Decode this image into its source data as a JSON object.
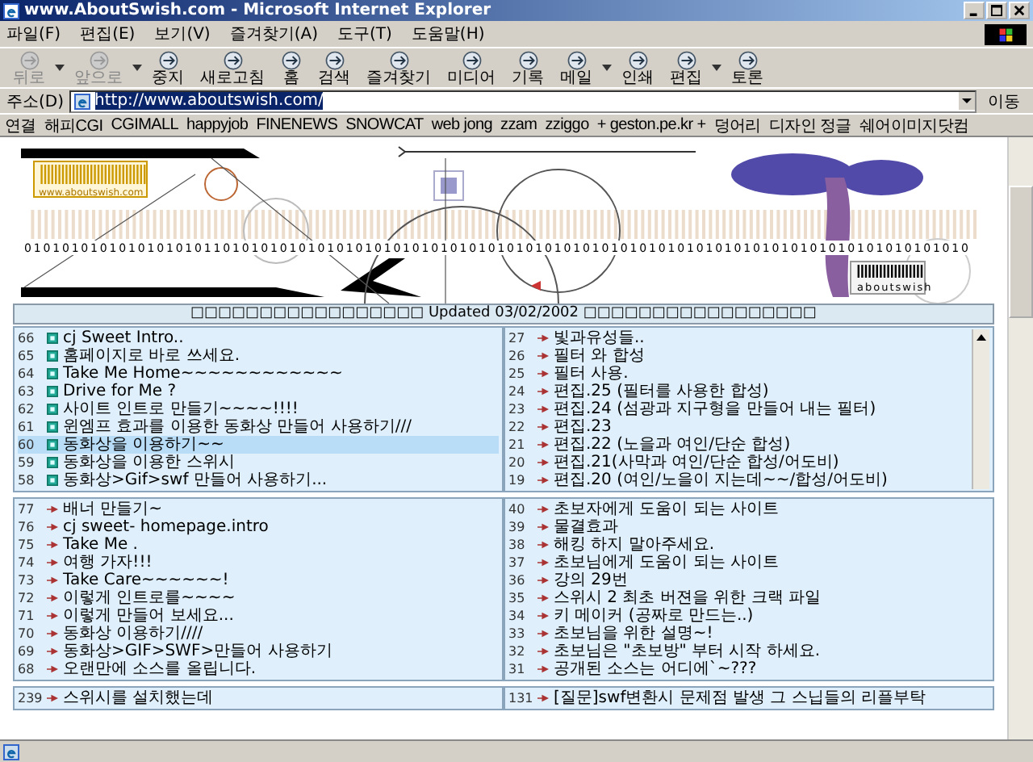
{
  "window": {
    "title": "www.AboutSwish.com - Microsoft Internet Explorer"
  },
  "menu": [
    "파일(F)",
    "편집(E)",
    "보기(V)",
    "즐겨찾기(A)",
    "도구(T)",
    "도움말(H)"
  ],
  "toolbar": [
    {
      "label": "뒤로",
      "disabled": true,
      "caret": true
    },
    {
      "label": "앞으로",
      "disabled": true,
      "caret": true
    },
    {
      "label": "중지",
      "disabled": false,
      "caret": false
    },
    {
      "label": "새로고침",
      "disabled": false,
      "caret": false
    },
    {
      "label": "홈",
      "disabled": false,
      "caret": false
    },
    {
      "label": "검색",
      "disabled": false,
      "caret": false
    },
    {
      "label": "즐겨찾기",
      "disabled": false,
      "caret": false
    },
    {
      "label": "미디어",
      "disabled": false,
      "caret": false
    },
    {
      "label": "기록",
      "disabled": false,
      "caret": false
    },
    {
      "label": "메일",
      "disabled": false,
      "caret": true
    },
    {
      "label": "인쇄",
      "disabled": false,
      "caret": false
    },
    {
      "label": "편집",
      "disabled": false,
      "caret": true
    },
    {
      "label": "토론",
      "disabled": false,
      "caret": false
    }
  ],
  "address": {
    "label": "주소(D)",
    "value": "http://www.aboutswish.com/",
    "go": "이동"
  },
  "links": {
    "label": "연결",
    "items": [
      "해피CGI",
      "CGIMALL",
      "happyjob",
      "FINENEWS",
      "SNOWCAT",
      "web jong",
      "zzam",
      "zziggo",
      "+ geston.pe.kr +",
      "덩어리",
      "디자인 정글",
      "쉐어이미지닷컴"
    ]
  },
  "banner": {
    "site_label": "www.aboutswish.com",
    "binary": "0101010101010101010110101010101010101010101010101010101010101010101010101010101010101010101010101010",
    "brand": "aboutswish"
  },
  "update_bar": {
    "text": "□□□□□□□□□□□□□□□□□ Updated  03/02/2002 □□□□□□□□□□□□□□□□□"
  },
  "boards": [
    {
      "kind": "square",
      "scrollbar": false,
      "rows": [
        {
          "num": "66",
          "title": "cj Sweet Intro..",
          "selected": false
        },
        {
          "num": "65",
          "title": "홈페이지로 바로 쓰세요.",
          "selected": false
        },
        {
          "num": "64",
          "title": "Take Me Home~~~~~~~~~~~~",
          "selected": false
        },
        {
          "num": "63",
          "title": "Drive for Me ?",
          "selected": false
        },
        {
          "num": "62",
          "title": "사이트 인트로 만들기~~~~!!!!",
          "selected": false
        },
        {
          "num": "61",
          "title": "윈엠프 효과를 이용한 동화상 만들어 사용하기///",
          "selected": false
        },
        {
          "num": "60",
          "title": "동화상을 이용하기~~",
          "selected": true
        },
        {
          "num": "59",
          "title": "동화상을 이용한 스위시",
          "selected": false
        },
        {
          "num": "58",
          "title": "동화상>Gif>swf 만들어 사용하기...",
          "selected": false
        }
      ]
    },
    {
      "kind": "arrow",
      "scrollbar": true,
      "rows": [
        {
          "num": "27",
          "title": "빛과유성들..",
          "selected": false
        },
        {
          "num": "26",
          "title": "필터 와 합성",
          "selected": false
        },
        {
          "num": "25",
          "title": "필터 사용.",
          "selected": false
        },
        {
          "num": "24",
          "title": "편집.25 (필터를 사용한 합성)",
          "selected": false
        },
        {
          "num": "23",
          "title": "편집.24 (섬광과 지구형을 만들어 내는 필터)",
          "selected": false
        },
        {
          "num": "22",
          "title": "편집.23",
          "selected": false
        },
        {
          "num": "21",
          "title": "편집.22 (노을과 여인/단순 합성)",
          "selected": false
        },
        {
          "num": "20",
          "title": "편집.21(사막과 여인/단순 합성/어도비)",
          "selected": false
        },
        {
          "num": "19",
          "title": "편집.20 (여인/노을이 지는데~~/합성/어도비)",
          "selected": false
        }
      ]
    },
    {
      "kind": "arrow",
      "scrollbar": false,
      "rows": [
        {
          "num": "77",
          "title": "배너 만들기~",
          "selected": false
        },
        {
          "num": "76",
          "title": "cj sweet- homepage.intro",
          "selected": false
        },
        {
          "num": "75",
          "title": "Take Me .",
          "selected": false
        },
        {
          "num": "74",
          "title": "여행 가자!!!",
          "selected": false
        },
        {
          "num": "73",
          "title": "Take Care~~~~~~!",
          "selected": false
        },
        {
          "num": "72",
          "title": "이렇게 인트로를~~~~",
          "selected": false
        },
        {
          "num": "71",
          "title": "이렇게 만들어 보세요...",
          "selected": false
        },
        {
          "num": "70",
          "title": "동화상 이용하기////",
          "selected": false
        },
        {
          "num": "69",
          "title": "동화상>GIF>SWF>만들어 사용하기",
          "selected": false
        },
        {
          "num": "68",
          "title": "오랜만에 소스를 올립니다.",
          "selected": false
        }
      ]
    },
    {
      "kind": "arrow",
      "scrollbar": false,
      "rows": [
        {
          "num": "40",
          "title": "초보자에게 도움이 되는 사이트",
          "selected": false
        },
        {
          "num": "39",
          "title": "물결효과",
          "selected": false
        },
        {
          "num": "38",
          "title": "해킹 하지 말아주세요.",
          "selected": false
        },
        {
          "num": "37",
          "title": "초보님에게 도움이 되는 사이트",
          "selected": false
        },
        {
          "num": "36",
          "title": "강의 29번",
          "selected": false
        },
        {
          "num": "35",
          "title": "스위시 2 최초 버젼을 위한 크랙 파일",
          "selected": false
        },
        {
          "num": "34",
          "title": "키 메이커 (공짜로 만드는..)",
          "selected": false
        },
        {
          "num": "33",
          "title": "초보님을 위한 설명~!",
          "selected": false
        },
        {
          "num": "32",
          "title": "초보님은 \"초보방\" 부터 시작 하세요.",
          "selected": false
        },
        {
          "num": "31",
          "title": "공개된 소스는 어디에`~???",
          "selected": false
        }
      ]
    },
    {
      "kind": "arrow",
      "scrollbar": false,
      "rows": [
        {
          "num": "239",
          "title": "스위시를 설치했는데",
          "selected": false
        }
      ]
    },
    {
      "kind": "arrow",
      "scrollbar": false,
      "rows": [
        {
          "num": "131",
          "title": "[질문]swf변환시 문제점 발생 그 스닙들의 리플부탁",
          "selected": false
        }
      ]
    }
  ]
}
